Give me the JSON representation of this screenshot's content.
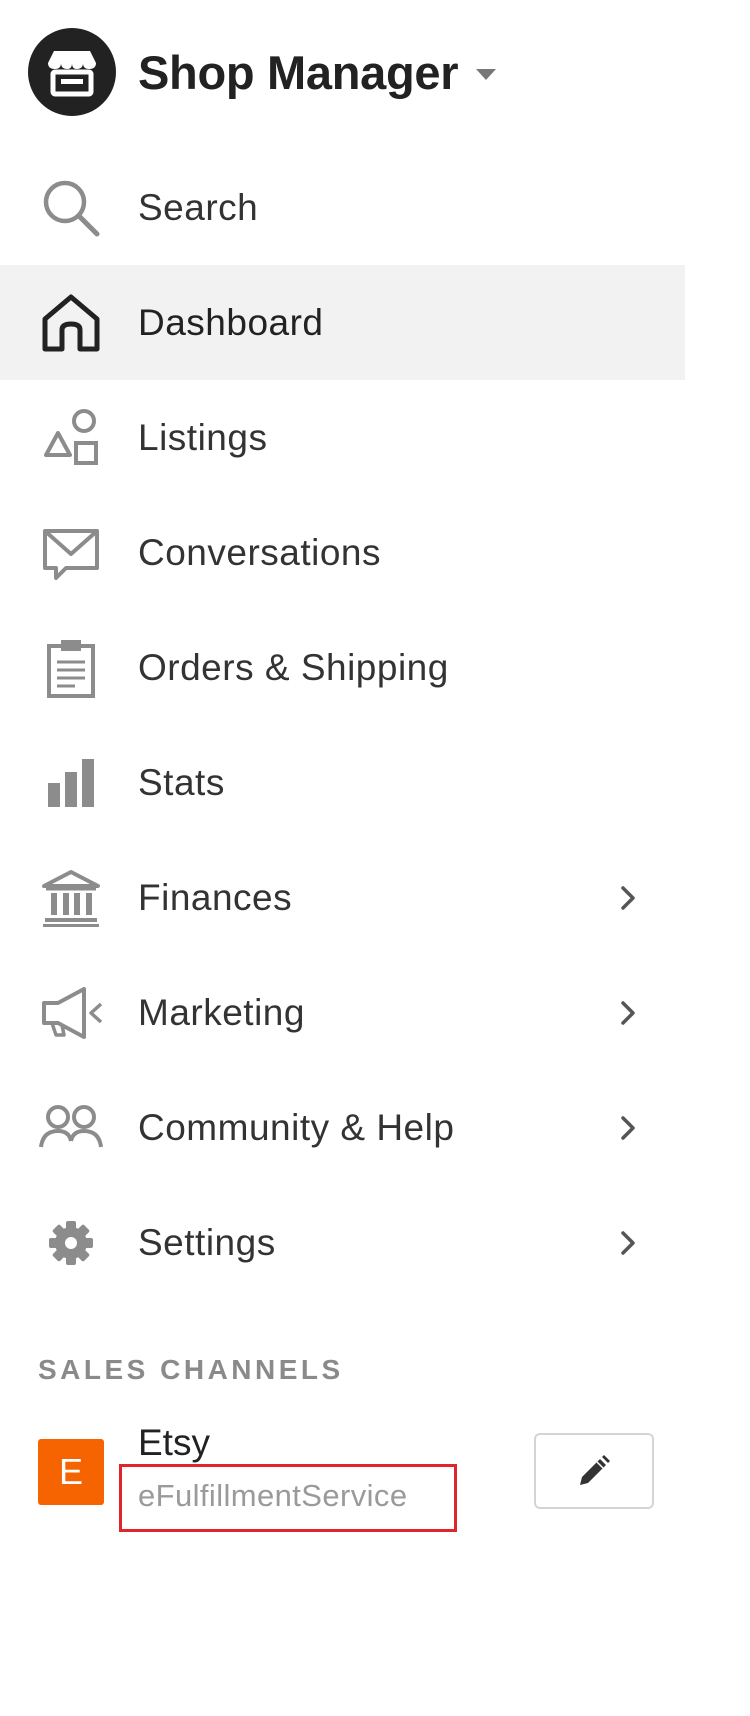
{
  "header": {
    "title": "Shop Manager",
    "logo_icon": "storefront-icon",
    "caret_icon": "caret-down-icon"
  },
  "nav": {
    "items": [
      {
        "label": "Search",
        "icon": "search-icon",
        "active": false,
        "has_chevron": false
      },
      {
        "label": "Dashboard",
        "icon": "home-icon",
        "active": true,
        "has_chevron": false
      },
      {
        "label": "Listings",
        "icon": "shapes-icon",
        "active": false,
        "has_chevron": false
      },
      {
        "label": "Conversations",
        "icon": "envelope-icon",
        "active": false,
        "has_chevron": false
      },
      {
        "label": "Orders & Shipping",
        "icon": "clipboard-icon",
        "active": false,
        "has_chevron": false
      },
      {
        "label": "Stats",
        "icon": "bar-chart-icon",
        "active": false,
        "has_chevron": false
      },
      {
        "label": "Finances",
        "icon": "bank-icon",
        "active": false,
        "has_chevron": true
      },
      {
        "label": "Marketing",
        "icon": "megaphone-icon",
        "active": false,
        "has_chevron": true
      },
      {
        "label": "Community & Help",
        "icon": "people-icon",
        "active": false,
        "has_chevron": true
      },
      {
        "label": "Settings",
        "icon": "gear-icon",
        "active": false,
        "has_chevron": true
      }
    ]
  },
  "sales_channels": {
    "header": "SALES CHANNELS",
    "channel": {
      "logo_letter": "E",
      "name": "Etsy",
      "shop_name": "eFulfillmentService",
      "edit_icon": "pencil-icon"
    }
  },
  "colors": {
    "active_bg": "#f2f2f2",
    "etsy_orange": "#f56400",
    "highlight_red": "#e0262a",
    "icon_gray": "#8c8c8c",
    "text_dark": "#222222"
  }
}
